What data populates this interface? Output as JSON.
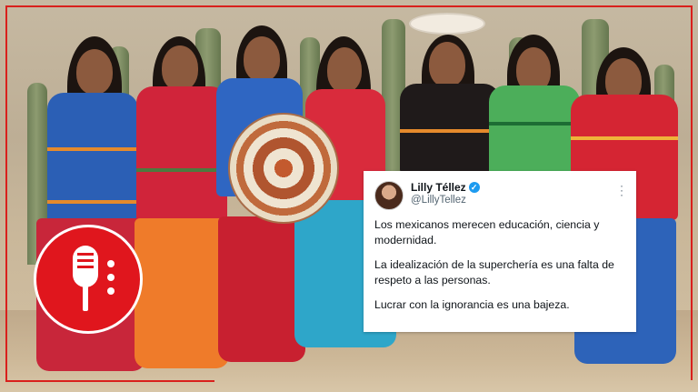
{
  "tweet": {
    "display_name": "Lilly Téllez",
    "handle": "@LillyTellez",
    "paragraphs": [
      "Los mexicanos merecen educación, ciencia y modernidad.",
      "La idealización de la superchería es una falta de respeto a las personas.",
      "Lucrar con la ignorancia es una bajeza."
    ]
  },
  "icons": {
    "verified": "verified-badge-icon",
    "more": "more-options-icon",
    "logo": "microphone-logo-icon"
  },
  "colors": {
    "accent_red": "#e0161d",
    "verified_blue": "#1d9bf0",
    "frame_red": "#d9201c"
  }
}
